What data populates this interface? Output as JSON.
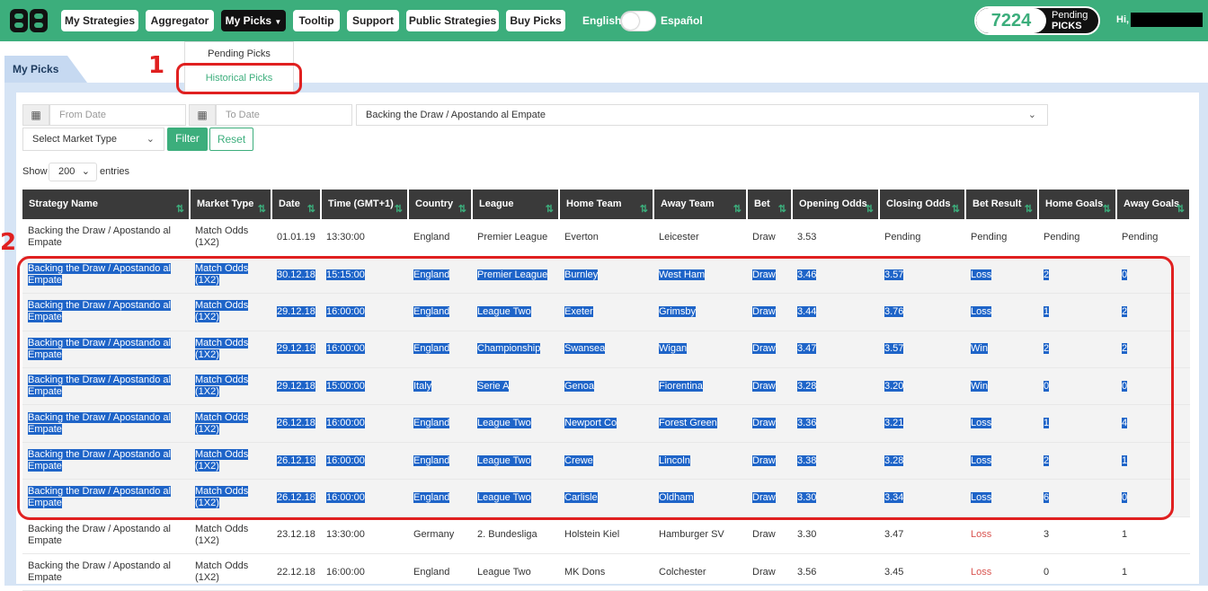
{
  "nav": {
    "items": [
      "My Strategies",
      "Aggregator",
      "My Picks",
      "Tooltip",
      "Support",
      "Public Strategies",
      "Buy Picks"
    ],
    "lang_en": "English",
    "lang_es": "Español",
    "counter": "7224",
    "counter_label1": "Pending",
    "counter_label2": "PICKS",
    "greeting": "Hi,"
  },
  "dropdown": {
    "pending": "Pending Picks",
    "historical": "Historical Picks"
  },
  "tab": "My Picks",
  "annotations": {
    "m1": "1",
    "m2": "2"
  },
  "filters": {
    "from_placeholder": "From Date",
    "to_placeholder": "To Date",
    "strategy": "Backing the Draw / Apostando al Empate",
    "market": "Select Market Type",
    "filter_btn": "Filter",
    "reset_btn": "Reset",
    "show_label": "Show",
    "show_value": "200",
    "entries_label": "entries"
  },
  "table": {
    "headers": [
      "Strategy Name",
      "Market Type",
      "Date",
      "Time (GMT+1)",
      "Country",
      "League",
      "Home Team",
      "Away Team",
      "Bet",
      "Opening Odds",
      "Closing Odds",
      "Bet Result",
      "Home Goals",
      "Away Goals"
    ],
    "rows": [
      [
        "Backing the Draw / Apostando al Empate",
        "Match Odds (1X2)",
        "01.01.19",
        "13:30:00",
        "England",
        "Premier League",
        "Everton",
        "Leicester",
        "Draw",
        "3.53",
        "Pending",
        "Pending",
        "Pending",
        "Pending"
      ],
      [
        "Backing the Draw / Apostando al Empate",
        "Match Odds (1X2)",
        "30.12.18",
        "15:15:00",
        "England",
        "Premier League",
        "Burnley",
        "West Ham",
        "Draw",
        "3.46",
        "3.57",
        "Loss",
        "2",
        "0"
      ],
      [
        "Backing the Draw / Apostando al Empate",
        "Match Odds (1X2)",
        "29.12.18",
        "16:00:00",
        "England",
        "League Two",
        "Exeter",
        "Grimsby",
        "Draw",
        "3.44",
        "3.76",
        "Loss",
        "1",
        "2"
      ],
      [
        "Backing the Draw / Apostando al Empate",
        "Match Odds (1X2)",
        "29.12.18",
        "16:00:00",
        "England",
        "Championship",
        "Swansea",
        "Wigan",
        "Draw",
        "3.47",
        "3.57",
        "Win",
        "2",
        "2"
      ],
      [
        "Backing the Draw / Apostando al Empate",
        "Match Odds (1X2)",
        "29.12.18",
        "15:00:00",
        "Italy",
        "Serie A",
        "Genoa",
        "Fiorentina",
        "Draw",
        "3.28",
        "3.20",
        "Win",
        "0",
        "0"
      ],
      [
        "Backing the Draw / Apostando al Empate",
        "Match Odds (1X2)",
        "26.12.18",
        "16:00:00",
        "England",
        "League Two",
        "Newport Co",
        "Forest Green",
        "Draw",
        "3.36",
        "3.21",
        "Loss",
        "1",
        "4"
      ],
      [
        "Backing the Draw / Apostando al Empate",
        "Match Odds (1X2)",
        "26.12.18",
        "16:00:00",
        "England",
        "League Two",
        "Crewe",
        "Lincoln",
        "Draw",
        "3.38",
        "3.28",
        "Loss",
        "2",
        "1"
      ],
      [
        "Backing the Draw / Apostando al Empate",
        "Match Odds (1X2)",
        "26.12.18",
        "16:00:00",
        "England",
        "League Two",
        "Carlisle",
        "Oldham",
        "Draw",
        "3.30",
        "3.34",
        "Loss",
        "6",
        "0"
      ],
      [
        "Backing the Draw / Apostando al Empate",
        "Match Odds (1X2)",
        "23.12.18",
        "13:30:00",
        "Germany",
        "2. Bundesliga",
        "Holstein Kiel",
        "Hamburger SV",
        "Draw",
        "3.30",
        "3.47",
        "Loss",
        "3",
        "1"
      ],
      [
        "Backing the Draw / Apostando al Empate",
        "Match Odds (1X2)",
        "22.12.18",
        "16:00:00",
        "England",
        "League Two",
        "MK Dons",
        "Colchester",
        "Draw",
        "3.56",
        "3.45",
        "Loss",
        "0",
        "1"
      ]
    ],
    "selected_rows": [
      1,
      2,
      3,
      4,
      5,
      6,
      7
    ]
  },
  "colors": {
    "brand": "#3cae7c",
    "loss": "#d9534f",
    "highlight": "#1e64c8"
  }
}
